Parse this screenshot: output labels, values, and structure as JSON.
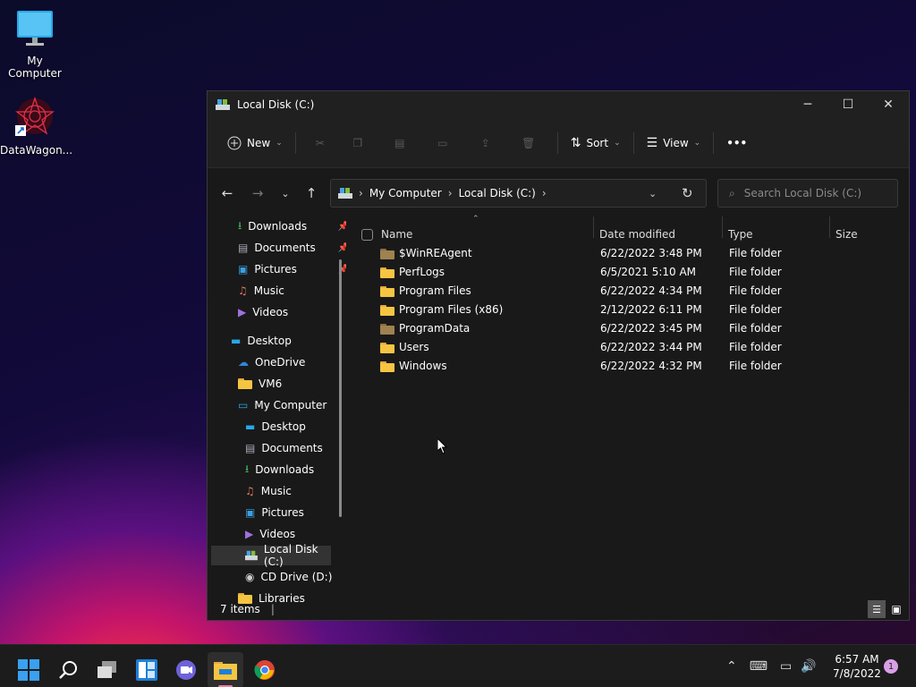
{
  "desktop": {
    "icons": [
      {
        "label": "My Computer",
        "icon": "monitor-icon"
      },
      {
        "label": "DataWagon...",
        "icon": "datawagon-app-icon"
      }
    ]
  },
  "window": {
    "title": "Local Disk (C:)",
    "title_icon": "drive-icon",
    "controls": {
      "minimize": "─",
      "maximize": "☐",
      "close": "✕"
    },
    "commands": {
      "new": "New",
      "sort": "Sort",
      "view": "View",
      "more": "•••"
    },
    "address": {
      "segments": [
        "My Computer",
        "Local Disk (C:)"
      ]
    },
    "search": {
      "placeholder": "Search Local Disk (C:)"
    },
    "sidebar": {
      "quick": [
        {
          "label": "Downloads",
          "icon": "download-icon",
          "pinned": true
        },
        {
          "label": "Documents",
          "icon": "document-icon",
          "pinned": true
        },
        {
          "label": "Pictures",
          "icon": "pictures-icon",
          "pinned": true
        },
        {
          "label": "Music",
          "icon": "music-icon",
          "pinned": false
        },
        {
          "label": "Videos",
          "icon": "videos-icon",
          "pinned": false
        }
      ],
      "desktop": "Desktop",
      "onedrive": "OneDrive",
      "vm6": "VM6",
      "my_computer": "My Computer",
      "computer_children": [
        {
          "label": "Desktop",
          "icon": "desktop-icon"
        },
        {
          "label": "Documents",
          "icon": "document-icon"
        },
        {
          "label": "Downloads",
          "icon": "download-icon"
        },
        {
          "label": "Music",
          "icon": "music-icon"
        },
        {
          "label": "Pictures",
          "icon": "pictures-icon"
        },
        {
          "label": "Videos",
          "icon": "videos-icon"
        },
        {
          "label": "Local Disk (C:)",
          "icon": "drive-icon",
          "selected": true
        },
        {
          "label": "CD Drive (D:)",
          "icon": "cd-drive-icon"
        }
      ],
      "libraries": "Libraries"
    },
    "columns": {
      "name": "Name",
      "date": "Date modified",
      "type": "Type",
      "size": "Size"
    },
    "files": [
      {
        "name": "$WinREAgent",
        "date": "6/22/2022 3:48 PM",
        "type": "File folder",
        "size": "",
        "system": true
      },
      {
        "name": "PerfLogs",
        "date": "6/5/2021 5:10 AM",
        "type": "File folder",
        "size": "",
        "system": false
      },
      {
        "name": "Program Files",
        "date": "6/22/2022 4:34 PM",
        "type": "File folder",
        "size": "",
        "system": false
      },
      {
        "name": "Program Files (x86)",
        "date": "2/12/2022 6:11 PM",
        "type": "File folder",
        "size": "",
        "system": false
      },
      {
        "name": "ProgramData",
        "date": "6/22/2022 3:45 PM",
        "type": "File folder",
        "size": "",
        "system": true
      },
      {
        "name": "Users",
        "date": "6/22/2022 3:44 PM",
        "type": "File folder",
        "size": "",
        "system": false
      },
      {
        "name": "Windows",
        "date": "6/22/2022 4:32 PM",
        "type": "File folder",
        "size": "",
        "system": false
      }
    ],
    "status": {
      "items": "7 items"
    }
  },
  "taskbar": {
    "apps": [
      "start-icon",
      "search-icon",
      "task-view-icon",
      "widgets-icon",
      "chat-icon",
      "file-explorer-icon",
      "chrome-icon"
    ],
    "time": "6:57 AM",
    "date": "7/8/2022",
    "notification_count": "1"
  },
  "colors": {
    "accent": "#4cc2ff",
    "folder": "#f5c542",
    "window_bg": "#191919",
    "taskbar_bg": "#1c1c1c"
  }
}
